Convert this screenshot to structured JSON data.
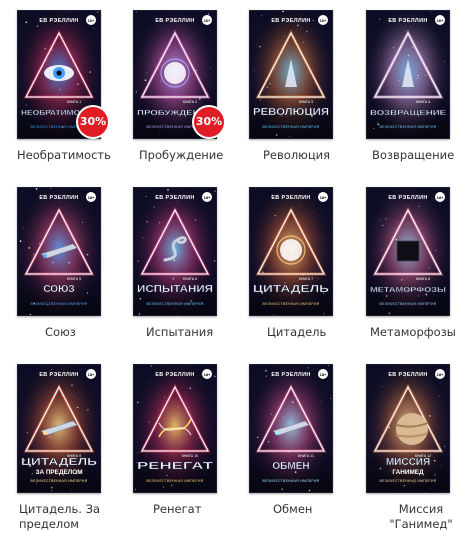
{
  "books": [
    {
      "id": "b1",
      "title": "Необратимость",
      "cover": {
        "author": "ЕВ РЭЕЛЛИН",
        "name": "НЕОБРАТИМОСТЬ",
        "series": "ВЕЛИЧЕСТВЕННАЯ ИМПЕРИЯ",
        "book": "КНИГА 1",
        "age": "16+",
        "accent": "#3fa0ff",
        "glow": "#ff3b6b",
        "motif": "eye"
      },
      "discount": "30%"
    },
    {
      "id": "b2",
      "title": "Пробуждение",
      "cover": {
        "author": "ЕВ РЭЕЛЛИН",
        "name": "ПРОБУЖДЕНИЕ",
        "series": "ВЕЛИЧЕСТВЕННАЯ ИМПЕРИЯ",
        "book": "КНИГА 2",
        "age": "16+",
        "accent": "#b7a8ff",
        "glow": "#ff6fd0",
        "motif": "orb"
      },
      "discount": "30%"
    },
    {
      "id": "b3",
      "title": "Революция",
      "cover": {
        "author": "ЕВ РЭЕЛЛИН",
        "name": "РЕВОЛЮЦИЯ",
        "series": "ВЕЛИЧЕСТВЕННАЯ ИМПЕРИЯ",
        "book": "КНИГА 3",
        "age": "16+",
        "accent": "#6ad0ff",
        "glow": "#ff8a3b",
        "motif": "figure"
      },
      "discount": null
    },
    {
      "id": "b4",
      "title": "Возвращение",
      "cover": {
        "author": "ЕВ РЭЕЛЛИН",
        "name": "ВОЗВРАЩЕНИЕ",
        "series": "ВЕЛИЧЕСТВЕННАЯ ИМПЕРИЯ",
        "book": "КНИГА 4",
        "age": "16+",
        "accent": "#7fc7ff",
        "glow": "#ffc0ff",
        "motif": "figure"
      },
      "discount": null
    },
    {
      "id": "b5",
      "title": "Союз",
      "cover": {
        "author": "ЕВ РЭЕЛЛИН",
        "name": "СОЮЗ",
        "series": "ВЕЛИЧЕСТВЕННАЯ ИМПЕРИЯ",
        "book": "КНИГА 5",
        "age": "18+",
        "accent": "#62a8ff",
        "glow": "#ff5a8a",
        "motif": "ship"
      },
      "discount": null
    },
    {
      "id": "b6",
      "title": "Испытания",
      "cover": {
        "author": "ЕВ РЭЕЛЛИН",
        "name": "ИСПЫТАНИЯ",
        "series": "ВЕЛИЧЕСТВЕННАЯ ИМПЕРИЯ",
        "book": "КНИГА 6",
        "age": "18+",
        "accent": "#6fd3ff",
        "glow": "#ff4f9a",
        "motif": "serpent"
      },
      "discount": null
    },
    {
      "id": "b7",
      "title": "Цитадель",
      "cover": {
        "author": "ЕВ РЭЕЛЛИН",
        "name": "ЦИТАДЕЛЬ",
        "series": "ВЕЛИЧЕСТВЕННАЯ ИМПЕРИЯ",
        "book": "КНИГА 7",
        "age": "18+",
        "accent": "#ffd27f",
        "glow": "#ff7a3b",
        "motif": "orb"
      },
      "discount": null
    },
    {
      "id": "b8",
      "title": "Метаморфозы",
      "cover": {
        "author": "ЕВ РЭЕЛЛИН",
        "name": "МЕТАМОРФОЗЫ",
        "series": "ВЕЛИЧЕСТВЕННАЯ ИМПЕРИЯ",
        "book": "КНИГА 8",
        "age": "18+",
        "accent": "#9ad7ff",
        "glow": "#ff7aa8",
        "motif": "cube"
      },
      "discount": null
    },
    {
      "id": "b9",
      "title": "Цитадель. За пределом",
      "cover": {
        "author": "ЕВ РЭЕЛЛИН",
        "name": "ЦИТАДЕЛЬ",
        "subname": "ЗА ПРЕДЕЛОМ",
        "series": "ВЕЛИЧЕСТВЕННАЯ ИМПЕРИЯ",
        "book": "КНИГА 9",
        "age": "18+",
        "accent": "#ffe08a",
        "glow": "#ff6f3b",
        "motif": "ship"
      },
      "discount": null
    },
    {
      "id": "b10",
      "title": "Ренегат",
      "cover": {
        "author": "ЕВ РЭЕЛЛИН",
        "name": "РЕНЕГАТ",
        "series": "ВЕЛИЧЕСТВЕННАЯ ИМПЕРИЯ",
        "book": "КНИГА 10",
        "age": "18+",
        "accent": "#ffd86a",
        "glow": "#ff3b6b",
        "motif": "helix"
      },
      "discount": null
    },
    {
      "id": "b11",
      "title": "Обмен",
      "cover": {
        "author": "ЕВ РЭЕЛЛИН",
        "name": "ОБМЕН",
        "series": "ВЕЛИЧЕСТВЕННАЯ ИМПЕРИЯ",
        "book": "КНИГА 11",
        "age": "18+",
        "accent": "#9ee6ff",
        "glow": "#ff5f9f",
        "motif": "ship"
      },
      "discount": null
    },
    {
      "id": "b12",
      "title": "Миссия \"Ганимед\"",
      "cover": {
        "author": "ЕВ РЭЕЛЛИН",
        "name": "МИССИЯ",
        "subname": "ГАНИМЕД",
        "series": "ВЕЛИЧЕСТВЕННАЯ ИМПЕРИЯ",
        "book": "КНИГА 12",
        "age": "18+",
        "accent": "#ffd9a0",
        "glow": "#ff8f4f",
        "motif": "planet"
      },
      "discount": null
    }
  ]
}
